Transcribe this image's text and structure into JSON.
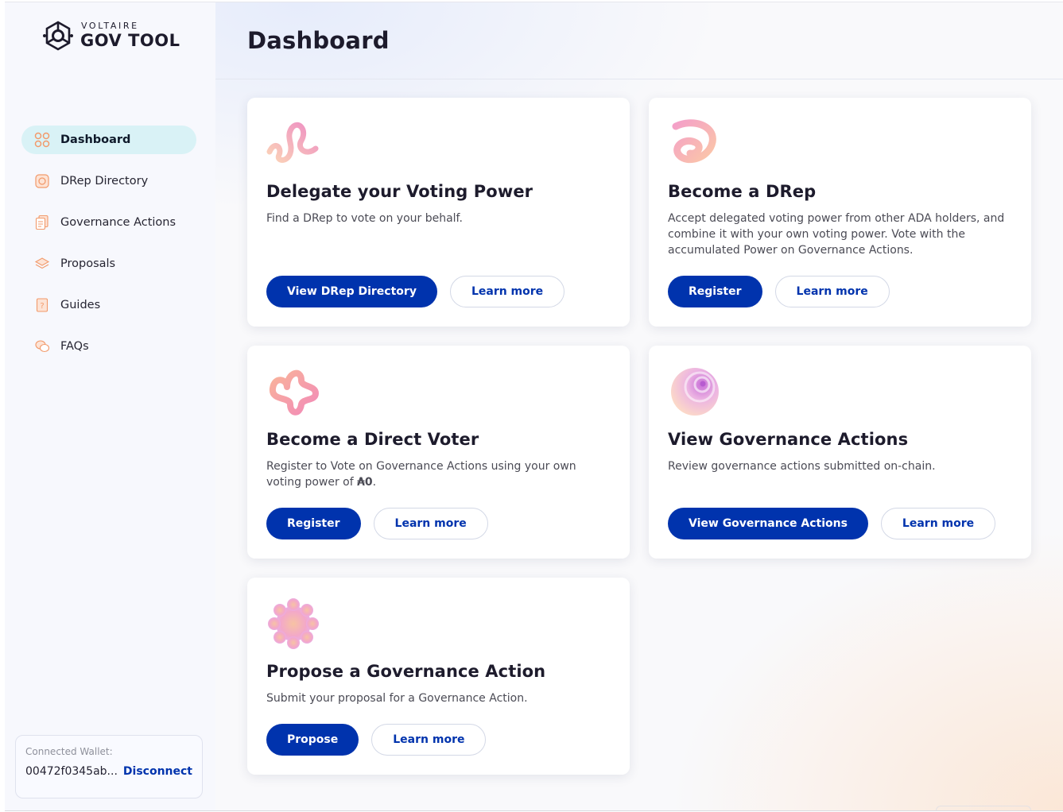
{
  "logo": {
    "top": "VOLTAIRE",
    "bottom": "GOV TOOL"
  },
  "sidebar": {
    "items": [
      {
        "label": "Dashboard",
        "icon": "dashboard-grid-icon",
        "active": true
      },
      {
        "label": "DRep Directory",
        "icon": "drep-directory-icon",
        "active": false
      },
      {
        "label": "Governance Actions",
        "icon": "governance-actions-icon",
        "active": false
      },
      {
        "label": "Proposals",
        "icon": "proposals-layers-icon",
        "active": false
      },
      {
        "label": "Guides",
        "icon": "guides-book-icon",
        "active": false
      },
      {
        "label": "FAQs",
        "icon": "faq-chat-icon",
        "active": false
      }
    ]
  },
  "wallet": {
    "label": "Connected Wallet:",
    "address": "00472f0345ab...",
    "disconnect": "Disconnect"
  },
  "header": {
    "title": "Dashboard"
  },
  "cards": [
    {
      "title": "Delegate your Voting Power",
      "description": "Find a DRep to vote on your behalf.",
      "primary": "View DRep Directory",
      "secondary": "Learn more",
      "icon": "spiral-ribbon-icon"
    },
    {
      "title": "Become a DRep",
      "description": "Accept delegated voting power from other ADA holders, and combine it with your own voting power. Vote with the accumulated Power on Governance Actions.",
      "primary": "Register",
      "secondary": "Learn more",
      "icon": "swirl-icon"
    },
    {
      "title": "Become a Direct Voter",
      "description_prefix": "Register to Vote on Governance Actions using your own voting power of ",
      "description_amount": "₳0",
      "description_suffix": ".",
      "primary": "Register",
      "secondary": "Learn more",
      "icon": "knot-icon"
    },
    {
      "title": "View Governance Actions",
      "description": "Review governance actions submitted on-chain.",
      "primary": "View Governance Actions",
      "secondary": "Learn more",
      "icon": "shell-icon"
    },
    {
      "title": "Propose a Governance Action",
      "description": "Submit your proposal for a Governance Action.",
      "primary": "Propose",
      "secondary": "Learn more",
      "icon": "flower-icon"
    }
  ],
  "colors": {
    "primary": "#0033ad",
    "active_nav": "#d9f2f6",
    "icon_accent": "#f29a6b"
  }
}
